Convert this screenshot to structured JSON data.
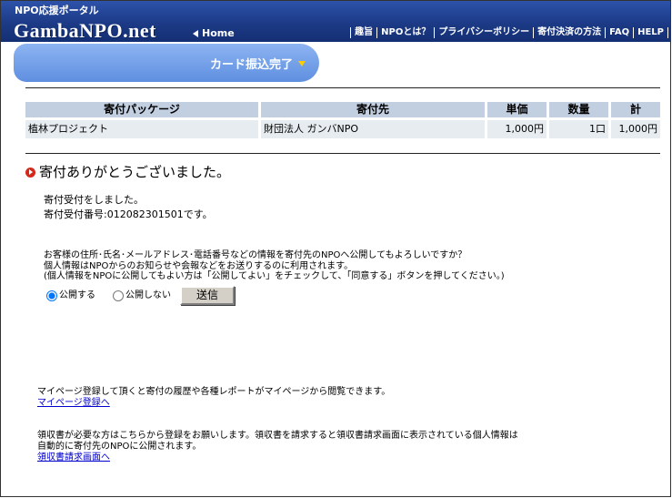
{
  "header": {
    "logo_sub": "NPO応援ポータル",
    "logo_main": "GambaNPO.net",
    "home_label": "Home",
    "nav": [
      "趣旨",
      "NPOとは？",
      "プライバシーポリシー",
      "寄付決済の方法",
      "FAQ",
      "HELP"
    ]
  },
  "banner": {
    "title": "カード振込完了"
  },
  "table": {
    "headers": [
      "寄付パッケージ",
      "寄付先",
      "単価",
      "数量",
      "計"
    ],
    "rows": [
      [
        "植林プロジェクト",
        "財団法人 ガンバNPO",
        "1,000円",
        "1口",
        "1,000円"
      ]
    ]
  },
  "thanks": {
    "heading": "寄付ありがとうございました。",
    "lines": [
      "寄付受付をしました。",
      "寄付受付番号:012082301501です。"
    ]
  },
  "disclosure": {
    "lines": [
      "お客様の住所･氏名･メールアドレス･電話番号などの情報を寄付先のNPOへ公開してもよろしいですか？",
      "個人情報はNPOからのお知らせや会報などをお送りするのに利用されます。",
      "(個人情報をNPOに公開してもよい方は「公開してよい」をチェックして、「同意する」ボタンを押してください。)"
    ],
    "options": [
      {
        "label": "公開する",
        "checked": true
      },
      {
        "label": "公開しない",
        "checked": false
      }
    ],
    "submit_label": "送信"
  },
  "mypage": {
    "text": "マイページ登録して頂くと寄付の履歴や各種レポートがマイページから閲覧できます。",
    "link": "マイページ登録へ"
  },
  "receipt": {
    "lines": [
      "領収書が必要な方はこちらから登録をお願いします。領収書を請求すると領収書請求画面に表示されている個人情報は",
      "自動的に寄付先のNPOに公開されます。"
    ],
    "link": "領収書請求画面へ"
  },
  "icons": {
    "home": "left-triangle-icon",
    "banner": "down-triangle-icon",
    "heading": "red-circle-arrow-icon"
  },
  "colors": {
    "header_top": "#2d53aa",
    "header_bg": "#1c3a86",
    "banner_top": "#8db4f2",
    "banner_bg": "#5f8fe0",
    "banner_arrow": "#ffcc00",
    "table_header_bg": "#c2cfe1",
    "table_cell_bg": "#e7ecf0",
    "bullet_red": "#d52a1b",
    "link": "#0000cc",
    "button_bg": "#d4d0c8"
  }
}
